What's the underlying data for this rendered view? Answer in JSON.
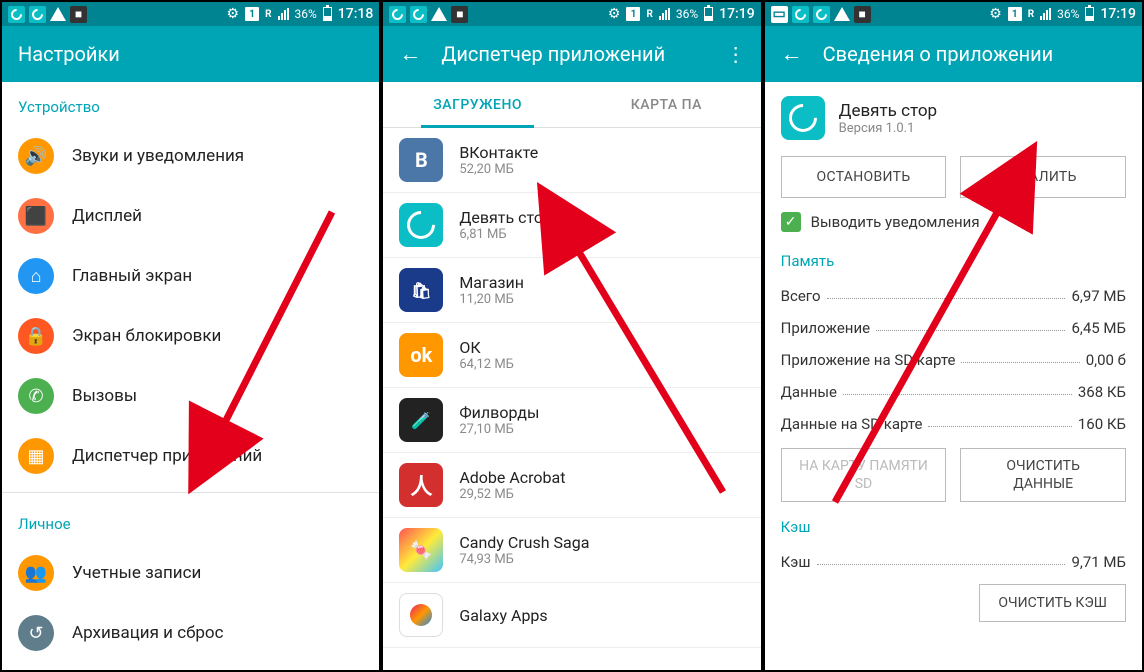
{
  "status": {
    "battery_pct": "36%",
    "time1": "17:18",
    "time2": "17:19",
    "time3": "17:19",
    "sim": "1",
    "r": "R"
  },
  "screen1": {
    "title": "Настройки",
    "section_device": "Устройство",
    "section_personal": "Личное",
    "items": {
      "sound": "Звуки и уведомления",
      "display": "Дисплей",
      "home": "Главный экран",
      "lock": "Экран блокировки",
      "calls": "Вызовы",
      "apps": "Диспетчер приложений",
      "accounts": "Учетные записи",
      "backup": "Архивация и сброс"
    }
  },
  "screen2": {
    "title": "Диспетчер приложений",
    "tabs": {
      "downloaded": "ЗАГРУЖЕНО",
      "sd": "КАРТА ПА"
    },
    "apps": {
      "vk": {
        "name": "ВКонтакте",
        "size": "52,20 МБ"
      },
      "nine": {
        "name": "Девять стор",
        "size": "6,81 МБ"
      },
      "store": {
        "name": "Магазин",
        "size": "11,20 МБ"
      },
      "ok": {
        "name": "ОК",
        "size": "64,12 МБ"
      },
      "fil": {
        "name": "Филворды",
        "size": "27,10 МБ"
      },
      "acrobat": {
        "name": "Adobe Acrobat",
        "size": "29,52 МБ"
      },
      "candy": {
        "name": "Candy Crush Saga",
        "size": "74,93 МБ"
      },
      "galaxy": {
        "name": "Galaxy Apps",
        "size": ""
      }
    }
  },
  "screen3": {
    "title": "Сведения о приложении",
    "app_name": "Девять стор",
    "version": "Версия 1.0.1",
    "btn_stop": "ОСТАНОВИТЬ",
    "btn_delete": "УДАЛИТЬ",
    "notify": "Выводить уведомления",
    "section_memory": "Память",
    "rows": {
      "total": {
        "k": "Всего",
        "v": "6,97 МБ"
      },
      "app": {
        "k": "Приложение",
        "v": "6,45 МБ"
      },
      "app_sd": {
        "k": "Приложение на SD карте",
        "v": "0,00 б"
      },
      "data": {
        "k": "Данные",
        "v": "368 КБ"
      },
      "data_sd": {
        "k": "Данные на SD карте",
        "v": "160 КБ"
      }
    },
    "btn_tosd1": "НА КАРТУ ПАМЯТИ",
    "btn_tosd2": "SD",
    "btn_clear1": "ОЧИСТИТЬ",
    "btn_clear2": "ДАННЫЕ",
    "section_cache": "Кэш",
    "cache_row": {
      "k": "Кэш",
      "v": "9,71 МБ"
    },
    "btn_clear_cache": "ОЧИСТИТЬ КЭШ"
  }
}
